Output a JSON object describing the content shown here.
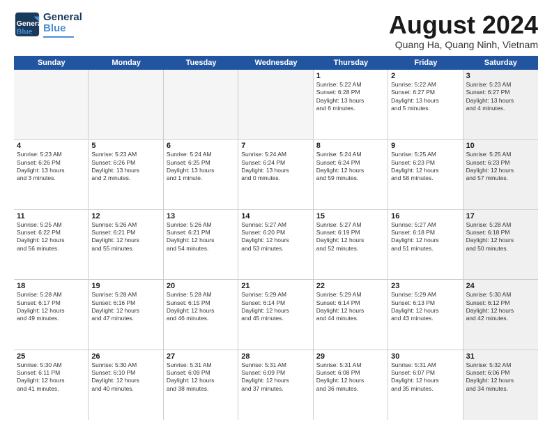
{
  "logo": {
    "line1": "General",
    "line2": "Blue"
  },
  "title": "August 2024",
  "location": "Quang Ha, Quang Ninh, Vietnam",
  "header_days": [
    "Sunday",
    "Monday",
    "Tuesday",
    "Wednesday",
    "Thursday",
    "Friday",
    "Saturday"
  ],
  "weeks": [
    [
      {
        "day": "",
        "info": "",
        "empty": true
      },
      {
        "day": "",
        "info": "",
        "empty": true
      },
      {
        "day": "",
        "info": "",
        "empty": true
      },
      {
        "day": "",
        "info": "",
        "empty": true
      },
      {
        "day": "1",
        "info": "Sunrise: 5:22 AM\nSunset: 6:28 PM\nDaylight: 13 hours\nand 6 minutes.",
        "empty": false
      },
      {
        "day": "2",
        "info": "Sunrise: 5:22 AM\nSunset: 6:27 PM\nDaylight: 13 hours\nand 5 minutes.",
        "empty": false
      },
      {
        "day": "3",
        "info": "Sunrise: 5:23 AM\nSunset: 6:27 PM\nDaylight: 13 hours\nand 4 minutes.",
        "empty": false,
        "shaded": true
      }
    ],
    [
      {
        "day": "4",
        "info": "Sunrise: 5:23 AM\nSunset: 6:26 PM\nDaylight: 13 hours\nand 3 minutes.",
        "empty": false
      },
      {
        "day": "5",
        "info": "Sunrise: 5:23 AM\nSunset: 6:26 PM\nDaylight: 13 hours\nand 2 minutes.",
        "empty": false
      },
      {
        "day": "6",
        "info": "Sunrise: 5:24 AM\nSunset: 6:25 PM\nDaylight: 13 hours\nand 1 minute.",
        "empty": false
      },
      {
        "day": "7",
        "info": "Sunrise: 5:24 AM\nSunset: 6:24 PM\nDaylight: 13 hours\nand 0 minutes.",
        "empty": false
      },
      {
        "day": "8",
        "info": "Sunrise: 5:24 AM\nSunset: 6:24 PM\nDaylight: 12 hours\nand 59 minutes.",
        "empty": false
      },
      {
        "day": "9",
        "info": "Sunrise: 5:25 AM\nSunset: 6:23 PM\nDaylight: 12 hours\nand 58 minutes.",
        "empty": false
      },
      {
        "day": "10",
        "info": "Sunrise: 5:25 AM\nSunset: 6:23 PM\nDaylight: 12 hours\nand 57 minutes.",
        "empty": false,
        "shaded": true
      }
    ],
    [
      {
        "day": "11",
        "info": "Sunrise: 5:25 AM\nSunset: 6:22 PM\nDaylight: 12 hours\nand 56 minutes.",
        "empty": false
      },
      {
        "day": "12",
        "info": "Sunrise: 5:26 AM\nSunset: 6:21 PM\nDaylight: 12 hours\nand 55 minutes.",
        "empty": false
      },
      {
        "day": "13",
        "info": "Sunrise: 5:26 AM\nSunset: 6:21 PM\nDaylight: 12 hours\nand 54 minutes.",
        "empty": false
      },
      {
        "day": "14",
        "info": "Sunrise: 5:27 AM\nSunset: 6:20 PM\nDaylight: 12 hours\nand 53 minutes.",
        "empty": false
      },
      {
        "day": "15",
        "info": "Sunrise: 5:27 AM\nSunset: 6:19 PM\nDaylight: 12 hours\nand 52 minutes.",
        "empty": false
      },
      {
        "day": "16",
        "info": "Sunrise: 5:27 AM\nSunset: 6:18 PM\nDaylight: 12 hours\nand 51 minutes.",
        "empty": false
      },
      {
        "day": "17",
        "info": "Sunrise: 5:28 AM\nSunset: 6:18 PM\nDaylight: 12 hours\nand 50 minutes.",
        "empty": false,
        "shaded": true
      }
    ],
    [
      {
        "day": "18",
        "info": "Sunrise: 5:28 AM\nSunset: 6:17 PM\nDaylight: 12 hours\nand 49 minutes.",
        "empty": false
      },
      {
        "day": "19",
        "info": "Sunrise: 5:28 AM\nSunset: 6:16 PM\nDaylight: 12 hours\nand 47 minutes.",
        "empty": false
      },
      {
        "day": "20",
        "info": "Sunrise: 5:28 AM\nSunset: 6:15 PM\nDaylight: 12 hours\nand 46 minutes.",
        "empty": false
      },
      {
        "day": "21",
        "info": "Sunrise: 5:29 AM\nSunset: 6:14 PM\nDaylight: 12 hours\nand 45 minutes.",
        "empty": false
      },
      {
        "day": "22",
        "info": "Sunrise: 5:29 AM\nSunset: 6:14 PM\nDaylight: 12 hours\nand 44 minutes.",
        "empty": false
      },
      {
        "day": "23",
        "info": "Sunrise: 5:29 AM\nSunset: 6:13 PM\nDaylight: 12 hours\nand 43 minutes.",
        "empty": false
      },
      {
        "day": "24",
        "info": "Sunrise: 5:30 AM\nSunset: 6:12 PM\nDaylight: 12 hours\nand 42 minutes.",
        "empty": false,
        "shaded": true
      }
    ],
    [
      {
        "day": "25",
        "info": "Sunrise: 5:30 AM\nSunset: 6:11 PM\nDaylight: 12 hours\nand 41 minutes.",
        "empty": false
      },
      {
        "day": "26",
        "info": "Sunrise: 5:30 AM\nSunset: 6:10 PM\nDaylight: 12 hours\nand 40 minutes.",
        "empty": false
      },
      {
        "day": "27",
        "info": "Sunrise: 5:31 AM\nSunset: 6:09 PM\nDaylight: 12 hours\nand 38 minutes.",
        "empty": false
      },
      {
        "day": "28",
        "info": "Sunrise: 5:31 AM\nSunset: 6:09 PM\nDaylight: 12 hours\nand 37 minutes.",
        "empty": false
      },
      {
        "day": "29",
        "info": "Sunrise: 5:31 AM\nSunset: 6:08 PM\nDaylight: 12 hours\nand 36 minutes.",
        "empty": false
      },
      {
        "day": "30",
        "info": "Sunrise: 5:31 AM\nSunset: 6:07 PM\nDaylight: 12 hours\nand 35 minutes.",
        "empty": false
      },
      {
        "day": "31",
        "info": "Sunrise: 5:32 AM\nSunset: 6:06 PM\nDaylight: 12 hours\nand 34 minutes.",
        "empty": false,
        "shaded": true
      }
    ]
  ]
}
